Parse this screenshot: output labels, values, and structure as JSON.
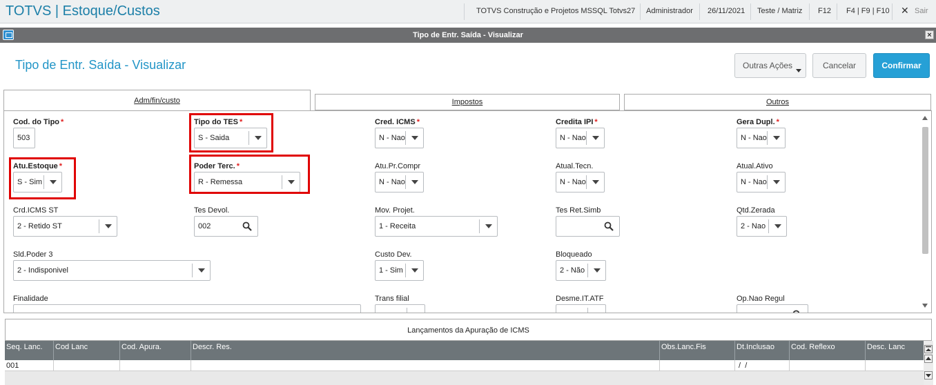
{
  "topbar": {
    "app_title": "TOTVS | Estoque/Custos",
    "company": "TOTVS Construção e Projetos MSSQL Totvs27",
    "user": "Administrador",
    "date": "26/11/2021",
    "branch": "Teste / Matriz",
    "f12": "F12",
    "fkeys": "F4 | F9 | F10",
    "exit_label": "Sair"
  },
  "window": {
    "title": "Tipo de Entr. Saída - Visualizar",
    "close_glyph": "×"
  },
  "header": {
    "page_title": "Tipo de Entr. Saída - Visualizar",
    "other_actions": "Outras Ações",
    "cancel": "Cancelar",
    "confirm": "Confirmar"
  },
  "tabs": [
    "Adm/fin/custo",
    "Impostos",
    "Outros"
  ],
  "fields": {
    "cod_tipo": {
      "label": "Cod. do Tipo",
      "value": "503"
    },
    "tipo_tes": {
      "label": "Tipo do TES",
      "value": "S - Saida"
    },
    "cred_icms": {
      "label": "Cred. ICMS",
      "value": "N - Nao"
    },
    "credita_ipi": {
      "label": "Credita IPI",
      "value": "N - Nao"
    },
    "gera_dupl": {
      "label": "Gera Dupl.",
      "value": "N - Nao"
    },
    "atu_estoque": {
      "label": "Atu.Estoque",
      "value": "S - Sim"
    },
    "poder_terc": {
      "label": "Poder Terc.",
      "value": "R - Remessa"
    },
    "atu_pr_compr": {
      "label": "Atu.Pr.Compr",
      "value": "N - Nao"
    },
    "atual_tecn": {
      "label": "Atual.Tecn.",
      "value": "N - Nao"
    },
    "atual_ativo": {
      "label": "Atual.Ativo",
      "value": "N - Nao"
    },
    "crd_icms_st": {
      "label": "Crd.ICMS ST",
      "value": "2 - Retido ST"
    },
    "tes_devol": {
      "label": "Tes Devol.",
      "value": "002"
    },
    "mov_projet": {
      "label": "Mov. Projet.",
      "value": "1 - Receita"
    },
    "tes_ret_simb": {
      "label": "Tes Ret.Simb",
      "value": ""
    },
    "qtd_zerada": {
      "label": "Qtd.Zerada",
      "value": "2 - Nao"
    },
    "sld_poder3": {
      "label": "Sld.Poder 3",
      "value": "2 - Indisponivel"
    },
    "custo_dev": {
      "label": "Custo Dev.",
      "value": "1 - Sim"
    },
    "bloqueado": {
      "label": "Bloqueado",
      "value": "2 - Não"
    },
    "finalidade": {
      "label": "Finalidade",
      "value": ""
    },
    "trans_filial": {
      "label": "Trans filial",
      "value": ""
    },
    "desme_it_atf": {
      "label": "Desme.IT.ATF",
      "value": ""
    },
    "op_nao_regul": {
      "label": "Op.Nao Regul",
      "value": ""
    }
  },
  "required_mark": "*",
  "grid": {
    "title": "Lançamentos da Apuração de ICMS",
    "columns": [
      "Seq. Lanc.",
      "Cod Lanc",
      "Cod. Apura.",
      "Descr. Res.",
      "Obs.Lanc.Fis",
      "Dt.Inclusao",
      "Cod. Reflexo",
      "Desc. Lanc"
    ],
    "rows": [
      [
        "001",
        "",
        "",
        "",
        "",
        " /  /",
        "",
        ""
      ]
    ]
  },
  "colors": {
    "accent": "#2295c7",
    "primary_button": "#26a0d6",
    "highlight": "#e00000",
    "required": "#e02020"
  }
}
